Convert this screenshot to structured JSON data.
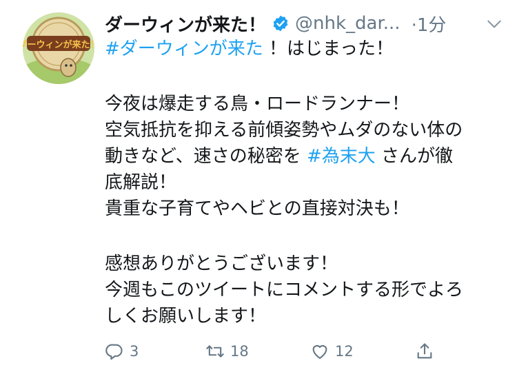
{
  "tweet": {
    "display_name": "ダーウィンが来た！",
    "handle": "@nhk_dar...",
    "time": "·1分",
    "body_lines": [
      {
        "hashtag": "#ダーウィンが来た",
        "text": " ！はじまった！"
      },
      {
        "text": ""
      },
      {
        "text": "今夜は爆走する鳥・ロードランナー！"
      },
      {
        "text": "空気抵抗を抑える前傾姿勢やムダのない体の"
      },
      {
        "prefix": "動きなど、速さの秘密を ",
        "hashtag": "#為末大",
        "suffix": " さんが徹"
      },
      {
        "text": "底解説！"
      },
      {
        "text": "貴重な子育てやヘビとの直接対決も！"
      },
      {
        "text": ""
      },
      {
        "text": "感想ありがとうございます！"
      },
      {
        "text": "今週もこのツイートにコメントする形でよろ"
      },
      {
        "text": "しくお願いします！"
      }
    ],
    "counts": {
      "replies": "3",
      "retweets": "18",
      "likes": "12"
    }
  },
  "avatar": {
    "logo_text": "ダーウィンが来た！"
  },
  "colors": {
    "hashtag": "#1da1f2",
    "secondary_text": "#657786",
    "verified": "#1da1f2"
  },
  "icons": [
    "verified-badge-icon",
    "chevron-down-icon",
    "reply-icon",
    "retweet-icon",
    "like-icon",
    "share-icon"
  ]
}
